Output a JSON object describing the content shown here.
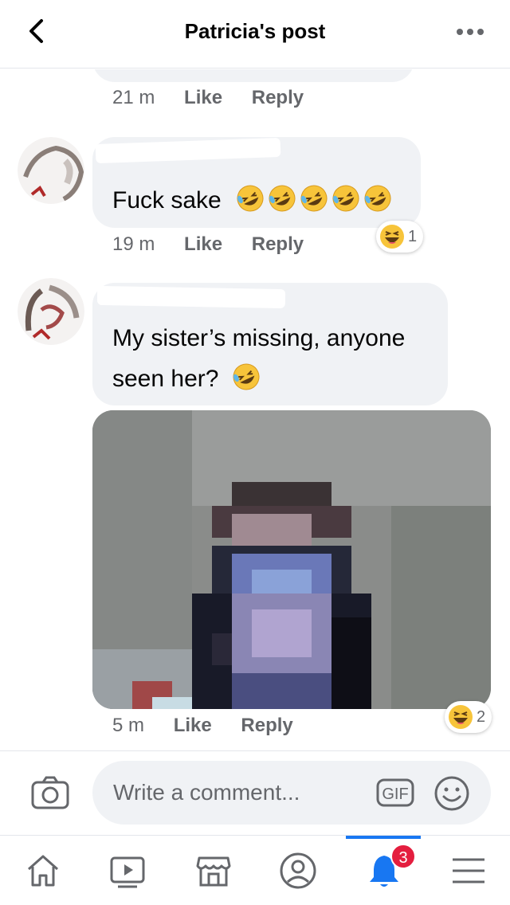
{
  "header": {
    "title": "Patricia's post"
  },
  "comments": [
    {
      "time": "21 m",
      "like_label": "Like",
      "reply_label": "Reply"
    },
    {
      "text": "Fuck sake",
      "emoji": "rolling-on-floor-laughing x5",
      "time": "19 m",
      "like_label": "Like",
      "reply_label": "Reply",
      "reaction": {
        "type": "haha",
        "count": "1"
      }
    },
    {
      "text": "My sister’s missing, anyone",
      "text_line2": "seen her?",
      "emoji": "rolling-on-floor-laughing",
      "time": "5 m",
      "like_label": "Like",
      "reply_label": "Reply",
      "reaction": {
        "type": "haha",
        "count": "2"
      },
      "attachment": "pixelated-photo"
    }
  ],
  "composer": {
    "placeholder": "Write a comment...",
    "gif_label": "GIF"
  },
  "nav": {
    "items": [
      "home",
      "watch",
      "marketplace",
      "profile",
      "notifications",
      "menu"
    ],
    "active": "notifications",
    "notification_badge": "3"
  },
  "colors": {
    "accent": "#1877f2",
    "bubble": "#f0f2f5",
    "badge": "#e41e3f",
    "muted_text": "#65676b"
  }
}
